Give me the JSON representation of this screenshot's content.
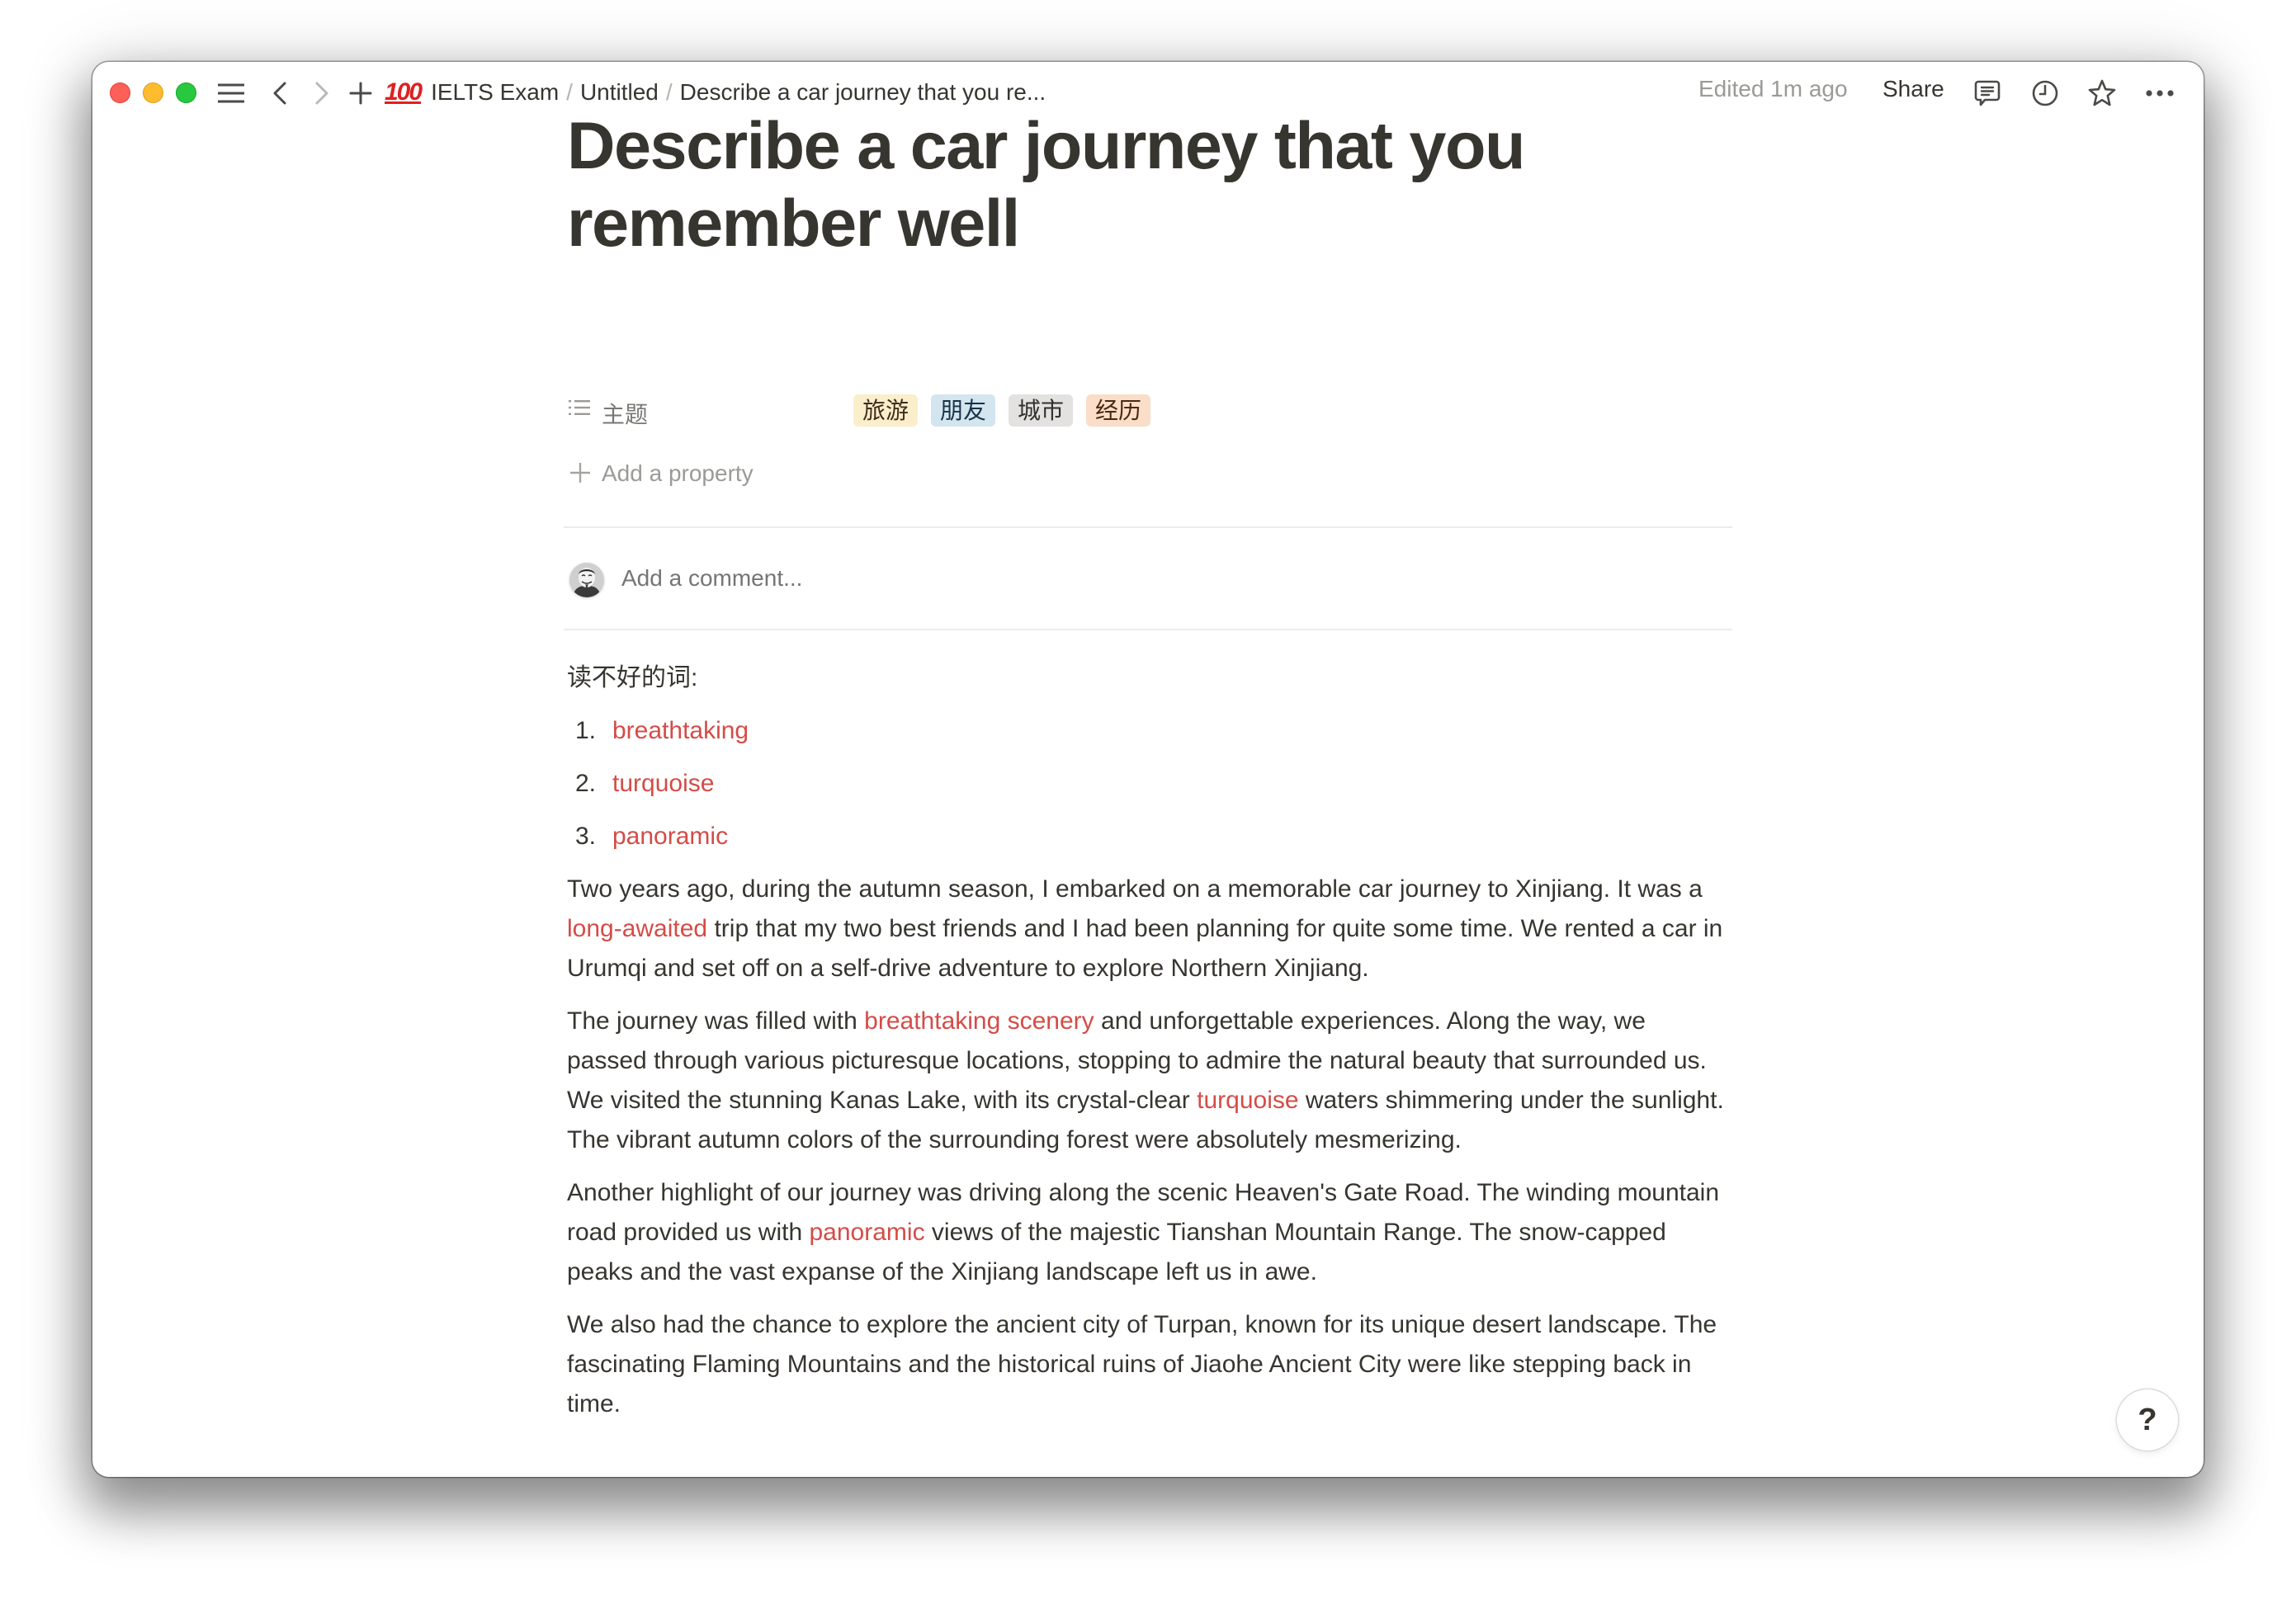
{
  "window": {
    "traffic_lights": [
      "close",
      "minimize",
      "zoom"
    ]
  },
  "topbar": {
    "icons": {
      "menu": "hamburger-menu-icon",
      "back": "chevron-left-icon",
      "forward": "chevron-right-icon",
      "new": "plus-icon",
      "comments": "comment-icon",
      "updates": "clock-icon",
      "favorite": "star-icon",
      "more": "more-horizontal-icon"
    },
    "breadcrumb": {
      "emoji": "100",
      "items": [
        "IELTS Exam",
        "Untitled",
        "Describe a car journey that you re..."
      ],
      "separator": "/"
    },
    "edited": "Edited 1m ago",
    "share": "Share"
  },
  "page": {
    "title": "Describe a car journey that you remember well",
    "property": {
      "icon": "list-icon",
      "label": "主题",
      "tags": [
        {
          "label": "旅游",
          "bg": "#FBEECB",
          "fg": "#402C1B"
        },
        {
          "label": "朋友",
          "bg": "#D3E5EF",
          "fg": "#183347"
        },
        {
          "label": "城市",
          "bg": "#E3E2E0",
          "fg": "#32302C"
        },
        {
          "label": "经历",
          "bg": "#FADEC9",
          "fg": "#49290E"
        }
      ]
    },
    "add_property": "Add a property",
    "comment_placeholder": "Add a comment...",
    "heading": "读不好的词:",
    "word_list": [
      {
        "num": "1.",
        "word": "breathtaking"
      },
      {
        "num": "2.",
        "word": "turquoise"
      },
      {
        "num": "3.",
        "word": "panoramic"
      }
    ],
    "paragraphs": [
      [
        {
          "text": "Two years ago, during the autumn season, I embarked on a memorable car journey to Xinjiang. It was a "
        },
        {
          "text": "long-awaited",
          "highlight": true
        },
        {
          "text": " trip that my two best friends and I had been planning for quite some time. We rented a car in Urumqi and set off on a self-drive adventure to explore Northern Xinjiang."
        }
      ],
      [
        {
          "text": "The journey was filled with "
        },
        {
          "text": "breathtaking scenery",
          "highlight": true
        },
        {
          "text": " and unforgettable experiences. Along the way, we passed through various picturesque locations, stopping to admire the natural beauty that surrounded us. We visited the stunning Kanas Lake, with its crystal-clear "
        },
        {
          "text": "turquoise",
          "highlight": true
        },
        {
          "text": " waters shimmering under the sunlight. The vibrant autumn colors of the surrounding forest were absolutely mesmerizing."
        }
      ],
      [
        {
          "text": "Another highlight of our journey was driving along the scenic Heaven's Gate Road. The winding mountain road provided us with "
        },
        {
          "text": "panoramic",
          "highlight": true
        },
        {
          "text": " views of the majestic Tianshan Mountain Range. The snow-capped peaks and the vast expanse of the Xinjiang landscape left us in awe."
        }
      ],
      [
        {
          "text": "We also had the chance to explore the ancient city of Turpan, known for its unique desert landscape. The fascinating Flaming Mountains and the historical ruins of Jiaohe Ancient City were like stepping back in time."
        }
      ]
    ],
    "highlight_color": "#D44C47"
  },
  "help_button": "?"
}
